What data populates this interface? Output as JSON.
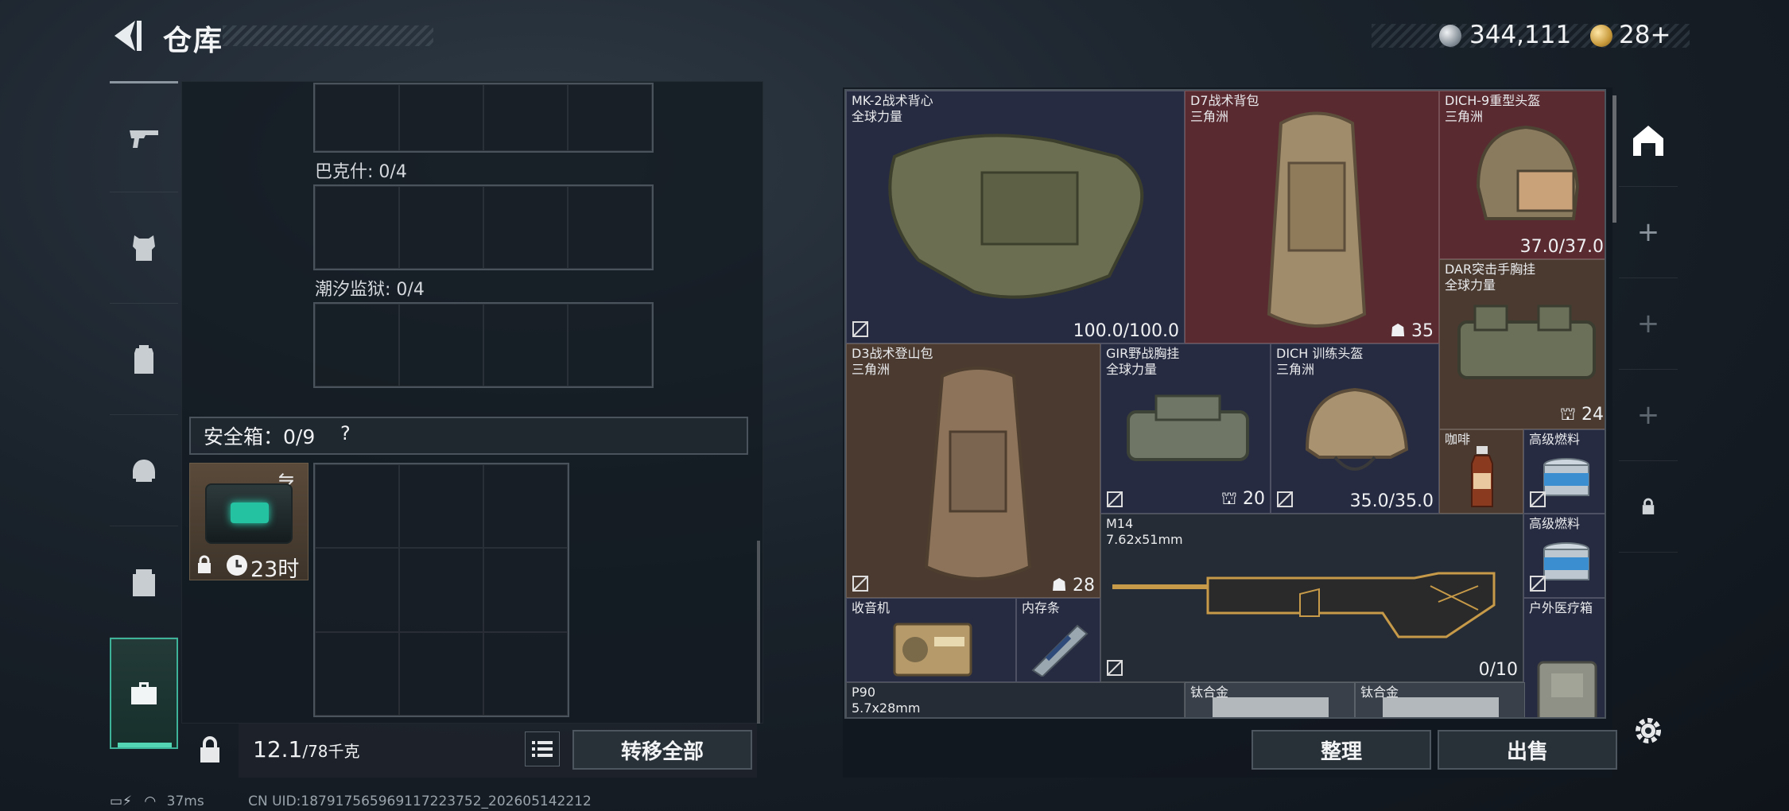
{
  "header": {
    "title": "仓库",
    "money": "344,111",
    "tickets": "28+"
  },
  "rail": {
    "items": [
      "weapon",
      "armor",
      "backpack",
      "chest-rig",
      "ammo",
      "case"
    ]
  },
  "left": {
    "sections": [
      {
        "label": "巴克什: 0/4"
      },
      {
        "label": "潮汐监狱: 0/4"
      }
    ],
    "safe": {
      "title": "安全箱：0/9",
      "help": "?",
      "timer": "23时"
    },
    "weight": {
      "current": "12.1",
      "max": "/78千克"
    },
    "transfer_all": "转移全部"
  },
  "items": [
    {
      "name": "MK-2战术背心",
      "sub": "全球力量",
      "value": "100.0/100.0"
    },
    {
      "name": "D7战术背包",
      "sub": "三角洲",
      "value": "35"
    },
    {
      "name": "DICH-9重型头盔",
      "sub": "三角洲",
      "value": "37.0/37.0"
    },
    {
      "name": "DAR突击手胸挂",
      "sub": "全球力量",
      "value": "24"
    },
    {
      "name": "D3战术登山包",
      "sub": "三角洲",
      "value": "28"
    },
    {
      "name": "GIR野战胸挂",
      "sub": "全球力量",
      "value": "20"
    },
    {
      "name": "DICH 训练头盔",
      "sub": "三角洲",
      "value": "35.0/35.0"
    },
    {
      "name": "咖啡",
      "sub": "",
      "value": ""
    },
    {
      "name": "高级燃料",
      "sub": "",
      "value": ""
    },
    {
      "name": "M14",
      "sub": "7.62x51mm",
      "value": "0/10"
    },
    {
      "name": "高级燃料",
      "sub": "",
      "value": ""
    },
    {
      "name": "收音机",
      "sub": "",
      "value": ""
    },
    {
      "name": "内存条",
      "sub": "",
      "value": ""
    },
    {
      "name": "户外医疗箱",
      "sub": "",
      "value": ""
    },
    {
      "name": "P90",
      "sub": "5.7x28mm",
      "value": ""
    },
    {
      "name": "钛合金",
      "sub": "",
      "value": ""
    },
    {
      "name": "钛合金",
      "sub": "",
      "value": ""
    }
  ],
  "buttons": {
    "sort": "整理",
    "sell": "出售"
  },
  "status": {
    "ping": "37ms",
    "uid": "CN UID:18791756596911722375​2_202605142212"
  },
  "colors": {
    "accent": "#3fb39a",
    "rare_red": "#5a2a31",
    "epic_purple": "#272b41",
    "brown": "#4a3a30"
  }
}
